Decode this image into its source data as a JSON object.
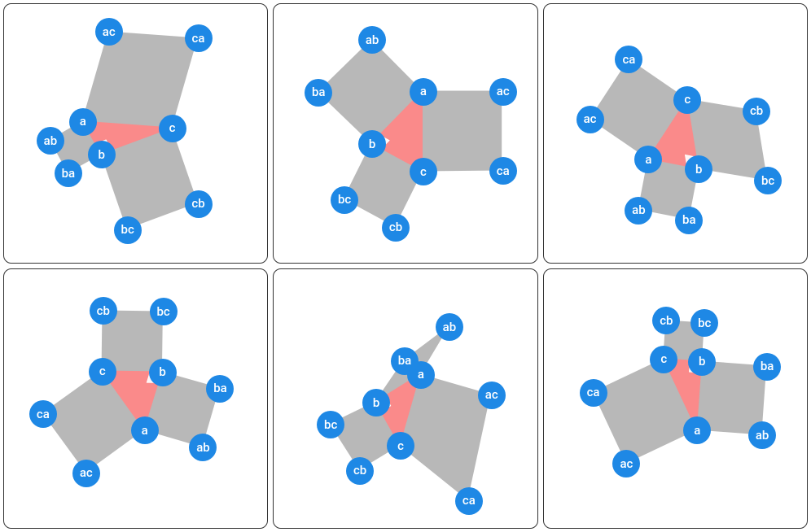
{
  "diagram": {
    "type": "pythagorean-triangle-variants",
    "grid": {
      "rows": 2,
      "cols": 3
    },
    "colors": {
      "square_fill": "#b8b8b8",
      "square_stroke": "#b8b8b8",
      "triangle_fill": "#fa8a8a",
      "vertex_fill": "#1e88e5",
      "vertex_text": "#ffffff",
      "panel_border": "#333333"
    },
    "panels": [
      {
        "id": 0,
        "triangle": {
          "a": [
            97,
            144
          ],
          "b": [
            120,
            184
          ],
          "c": [
            207,
            152
          ]
        },
        "vertices": [
          {
            "id": "a",
            "label": "a",
            "pos": [
              97,
              144
            ]
          },
          {
            "id": "b",
            "label": "b",
            "pos": [
              120,
              184
            ]
          },
          {
            "id": "c",
            "label": "c",
            "pos": [
              207,
              152
            ]
          },
          {
            "id": "ab",
            "label": "ab",
            "pos": [
              57,
              167
            ]
          },
          {
            "id": "ba",
            "label": "ba",
            "pos": [
              79,
              207
            ]
          },
          {
            "id": "ac",
            "label": "ac",
            "pos": [
              129,
              34
            ]
          },
          {
            "id": "ca",
            "label": "ca",
            "pos": [
              239,
              42
            ]
          },
          {
            "id": "bc",
            "label": "bc",
            "pos": [
              152,
              276
            ]
          },
          {
            "id": "cb",
            "label": "cb",
            "pos": [
              239,
              244
            ]
          }
        ]
      },
      {
        "id": 1,
        "triangle": {
          "a": [
            184,
            107
          ],
          "b": [
            121,
            171
          ],
          "c": [
            184,
            205
          ]
        },
        "vertices": [
          {
            "id": "a",
            "label": "a",
            "pos": [
              184,
              107
            ]
          },
          {
            "id": "b",
            "label": "b",
            "pos": [
              121,
              171
            ]
          },
          {
            "id": "c",
            "label": "c",
            "pos": [
              184,
              205
            ]
          },
          {
            "id": "ab",
            "label": "ab",
            "pos": [
              121,
              44
            ]
          },
          {
            "id": "ba",
            "label": "ba",
            "pos": [
              55,
              108
            ]
          },
          {
            "id": "bc",
            "label": "bc",
            "pos": [
              87,
              239
            ]
          },
          {
            "id": "cb",
            "label": "cb",
            "pos": [
              150,
              273
            ]
          },
          {
            "id": "ac",
            "label": "ac",
            "pos": [
              282,
              107
            ]
          },
          {
            "id": "ca",
            "label": "ca",
            "pos": [
              282,
              204
            ]
          }
        ]
      },
      {
        "id": 2,
        "triangle": {
          "a": [
            129,
            190
          ],
          "b": [
            191,
            202
          ],
          "c": [
            177,
            117
          ]
        },
        "vertices": [
          {
            "id": "a",
            "label": "a",
            "pos": [
              129,
              190
            ]
          },
          {
            "id": "b",
            "label": "b",
            "pos": [
              191,
              202
            ]
          },
          {
            "id": "c",
            "label": "c",
            "pos": [
              177,
              117
            ]
          },
          {
            "id": "ab",
            "label": "ab",
            "pos": [
              117,
              252
            ]
          },
          {
            "id": "ba",
            "label": "ba",
            "pos": [
              179,
              264
            ]
          },
          {
            "id": "ac",
            "label": "ac",
            "pos": [
              57,
              141
            ]
          },
          {
            "id": "ca",
            "label": "ca",
            "pos": [
              105,
              68
            ]
          },
          {
            "id": "cb",
            "label": "cb",
            "pos": [
              262,
              131
            ]
          },
          {
            "id": "bc",
            "label": "bc",
            "pos": [
              276,
              216
            ]
          }
        ]
      },
      {
        "id": 3,
        "triangle": {
          "a": [
            173,
            197
          ],
          "b": [
            195,
            126
          ],
          "c": [
            121,
            125
          ]
        },
        "vertices": [
          {
            "id": "a",
            "label": "a",
            "pos": [
              173,
              197
            ]
          },
          {
            "id": "b",
            "label": "b",
            "pos": [
              195,
              126
            ]
          },
          {
            "id": "c",
            "label": "c",
            "pos": [
              121,
              125
            ]
          },
          {
            "id": "ab",
            "label": "ab",
            "pos": [
              245,
              218
            ]
          },
          {
            "id": "ba",
            "label": "ba",
            "pos": [
              266,
              146
            ]
          },
          {
            "id": "cb",
            "label": "cb",
            "pos": [
              122,
              51
            ]
          },
          {
            "id": "bc",
            "label": "bc",
            "pos": [
              196,
              52
            ]
          },
          {
            "id": "ca",
            "label": "ca",
            "pos": [
              48,
              177
            ]
          },
          {
            "id": "ac",
            "label": "ac",
            "pos": [
              101,
              249
            ]
          }
        ]
      },
      {
        "id": 4,
        "triangle": {
          "a": [
            181,
            129
          ],
          "b": [
            126,
            163
          ],
          "c": [
            156,
            216
          ]
        },
        "vertices": [
          {
            "id": "a",
            "label": "a",
            "pos": [
              181,
              129
            ]
          },
          {
            "id": "b",
            "label": "b",
            "pos": [
              126,
              163
            ]
          },
          {
            "id": "c",
            "label": "c",
            "pos": [
              156,
              216
            ]
          },
          {
            "id": "ab",
            "label": "ab",
            "pos": [
              216,
              71
            ]
          },
          {
            "id": "ba",
            "label": "ba",
            "pos": [
              161,
              112
            ]
          },
          {
            "id": "bc",
            "label": "bc",
            "pos": [
              70,
              190
            ]
          },
          {
            "id": "cb",
            "label": "cb",
            "pos": [
              106,
              246
            ]
          },
          {
            "id": "ac",
            "label": "ac",
            "pos": [
              268,
              154
            ]
          },
          {
            "id": "ca",
            "label": "ca",
            "pos": [
              240,
              283
            ]
          }
        ]
      },
      {
        "id": 5,
        "triangle": {
          "a": [
            189,
            197
          ],
          "b": [
            195,
            113
          ],
          "c": [
            148,
            110
          ]
        },
        "vertices": [
          {
            "id": "a",
            "label": "a",
            "pos": [
              189,
              197
            ]
          },
          {
            "id": "b",
            "label": "b",
            "pos": [
              195,
              113
            ]
          },
          {
            "id": "c",
            "label": "c",
            "pos": [
              148,
              110
            ]
          },
          {
            "id": "ab",
            "label": "ab",
            "pos": [
              269,
              203
            ]
          },
          {
            "id": "ba",
            "label": "ba",
            "pos": [
              275,
              119
            ]
          },
          {
            "id": "cb",
            "label": "cb",
            "pos": [
              151,
              63
            ]
          },
          {
            "id": "bc",
            "label": "bc",
            "pos": [
              198,
              66
            ]
          },
          {
            "id": "ca",
            "label": "ca",
            "pos": [
              61,
              151
            ]
          },
          {
            "id": "ac",
            "label": "ac",
            "pos": [
              102,
              238
            ]
          }
        ]
      }
    ]
  }
}
